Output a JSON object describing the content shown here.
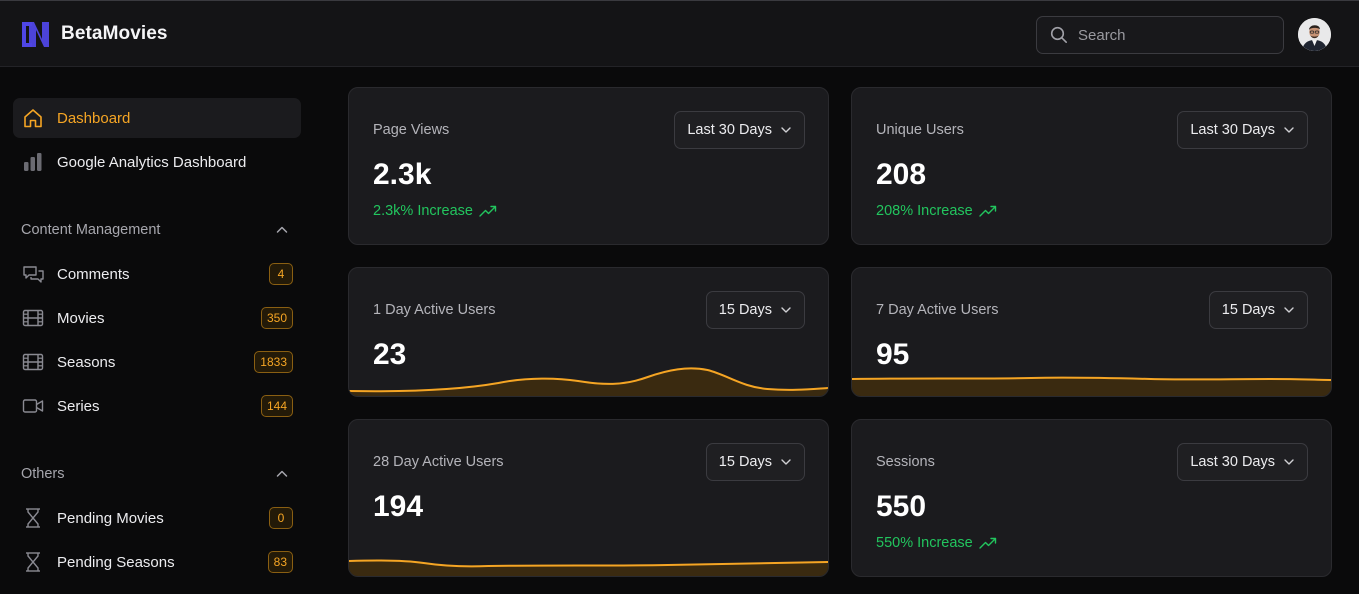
{
  "app": {
    "name": "BetaMovies"
  },
  "header": {
    "search_placeholder": "Search",
    "avatar_icon": "user-avatar"
  },
  "sidebar": {
    "main": [
      {
        "label": "Dashboard",
        "icon": "home-icon",
        "active": true
      },
      {
        "label": "Google Analytics Dashboard",
        "icon": "bar-chart-icon",
        "active": false
      }
    ],
    "content_management": {
      "title": "Content Management",
      "items": [
        {
          "label": "Comments",
          "icon": "comments-icon",
          "badge": "4"
        },
        {
          "label": "Movies",
          "icon": "film-icon",
          "badge": "350"
        },
        {
          "label": "Seasons",
          "icon": "film-icon",
          "badge": "1833"
        },
        {
          "label": "Series",
          "icon": "video-camera-icon",
          "badge": "144"
        }
      ]
    },
    "others": {
      "title": "Others",
      "items": [
        {
          "label": "Pending Movies",
          "icon": "hourglass-icon",
          "badge": "0"
        },
        {
          "label": "Pending Seasons",
          "icon": "hourglass-icon",
          "badge": "83"
        }
      ]
    }
  },
  "cards": {
    "page_views": {
      "title": "Page Views",
      "value": "2.3k",
      "trend": "2.3k% Increase",
      "range": "Last 30 Days"
    },
    "unique_users": {
      "title": "Unique Users",
      "value": "208",
      "trend": "208% Increase",
      "range": "Last 30 Days"
    },
    "day1_active": {
      "title": "1 Day Active Users",
      "value": "23",
      "range": "15 Days"
    },
    "day7_active": {
      "title": "7 Day Active Users",
      "value": "95",
      "range": "15 Days"
    },
    "day28_active": {
      "title": "28 Day Active Users",
      "value": "194",
      "range": "15 Days"
    },
    "sessions": {
      "title": "Sessions",
      "value": "550",
      "trend": "550% Increase",
      "range": "Last 30 Days"
    }
  },
  "colors": {
    "accent": "#f5a524",
    "increase": "#22c55e",
    "logo": "#4f46e5"
  }
}
